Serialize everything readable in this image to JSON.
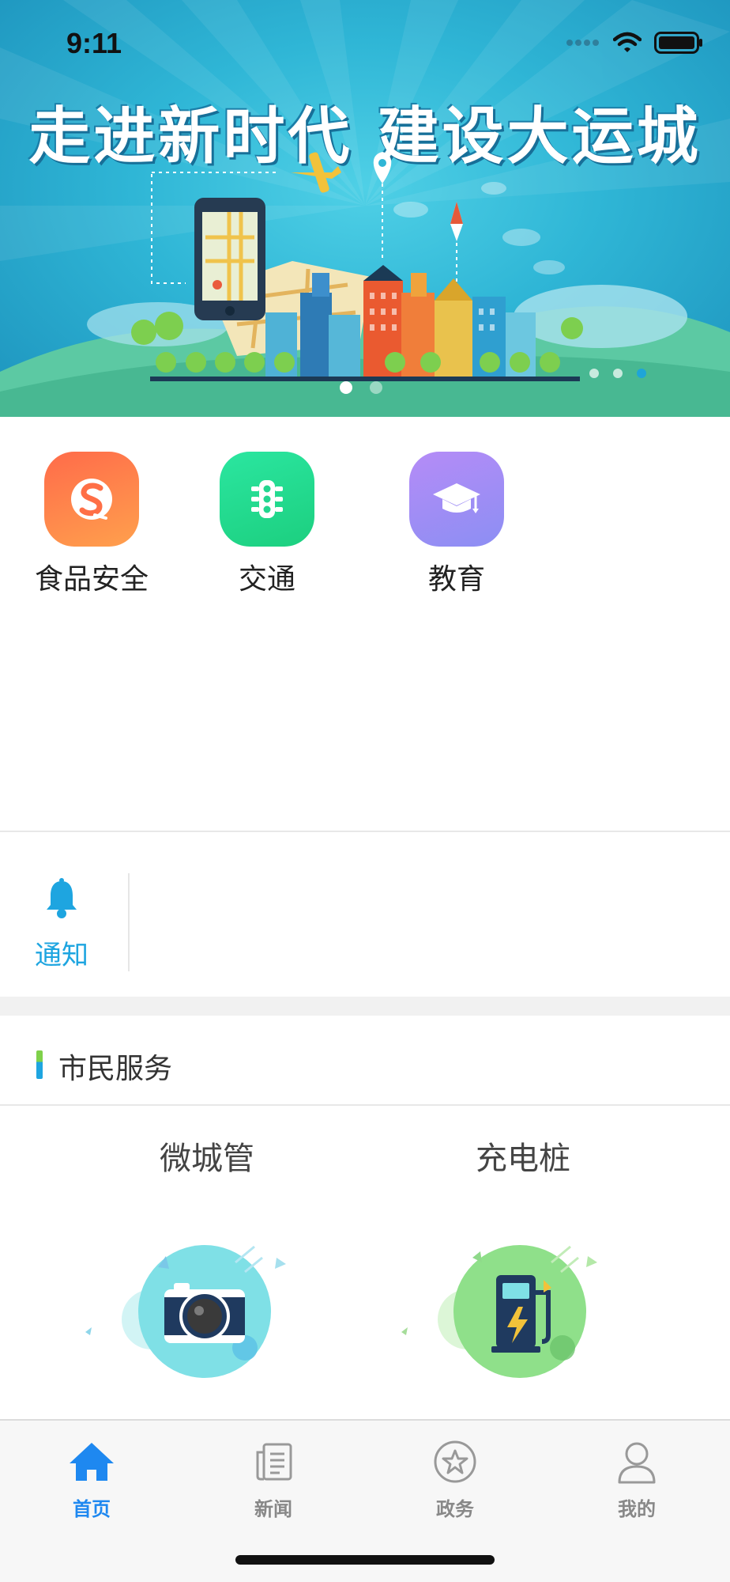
{
  "status_bar": {
    "time": "9:11"
  },
  "banner": {
    "title": "走进新时代 建设大运城",
    "slides_total": 2,
    "active_slide": 1
  },
  "services": [
    {
      "label": "食品安全",
      "icon": "food-safety-icon",
      "color": "#ff7a45"
    },
    {
      "label": "交通",
      "icon": "traffic-light-icon",
      "color": "#22d68f"
    },
    {
      "label": "教育",
      "icon": "graduation-cap-icon",
      "color": "#9b8cf5"
    }
  ],
  "notice": {
    "label": "通知",
    "icon": "bell-icon",
    "color": "#1ea5e0"
  },
  "citizen_services": {
    "title": "市民服务",
    "cards": [
      {
        "title": "微城管",
        "icon": "camera-icon"
      },
      {
        "title": "充电桩",
        "icon": "charging-pile-icon"
      }
    ]
  },
  "tab_bar": {
    "items": [
      {
        "label": "首页",
        "icon": "home-icon",
        "active": true
      },
      {
        "label": "新闻",
        "icon": "news-icon",
        "active": false
      },
      {
        "label": "政务",
        "icon": "government-star-icon",
        "active": false
      },
      {
        "label": "我的",
        "icon": "profile-icon",
        "active": false
      }
    ],
    "accent_color": "#1e88f0"
  }
}
